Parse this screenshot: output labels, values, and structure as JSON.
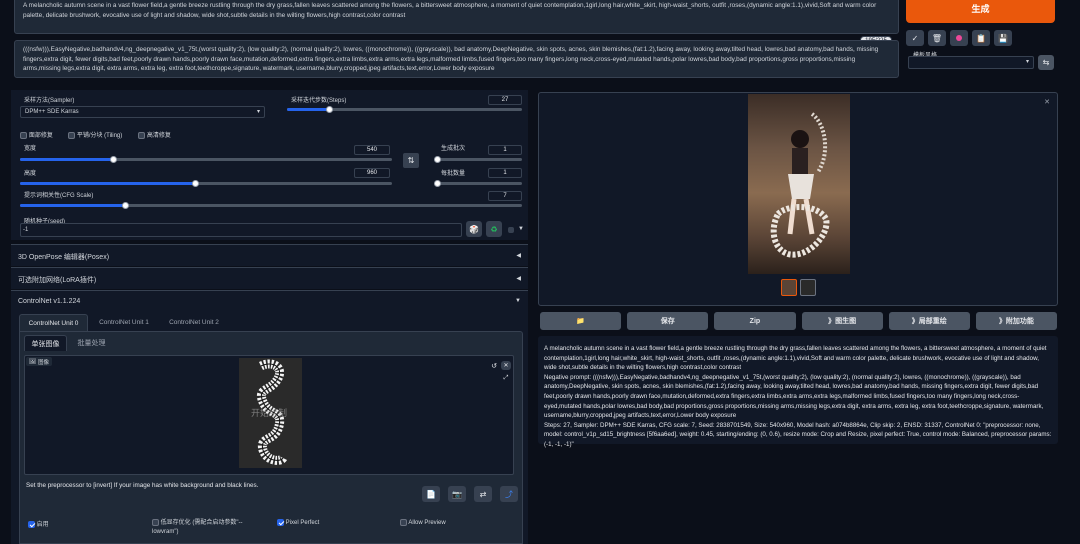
{
  "prompt": {
    "text": "A melancholic autumn scene in a vast flower field,a gentle breeze rustling through the dry grass,fallen leaves scattered among the flowers, a bittersweet atmosphere, a moment of quiet contemplation,1girl,long hair,white_skirt, high-waist_shorts, outfit ,roses,(dynamic angle:1.1),vivid,Soft and warm color palette, delicate brushwork, evocative use of light and shadow, wide shot,subtle details in the wilting flowers,high contrast,color contrast",
    "token_count": "195/225"
  },
  "negative_prompt": {
    "text": "(((nsfw))),EasyNegative,badhandv4,ng_deepnegative_v1_75t,(worst quality:2), (low quality:2), (normal quality:2), lowres, ((monochrome)), ((grayscale)), bad anatomy,DeepNegative, skin spots, acnes, skin blemishes,(fat:1.2),facing away, looking away,tilted head, lowres,bad anatomy,bad hands, missing fingers,extra digit, fewer digits,bad feet,poorly drawn hands,poorly drawn face,mutation,deformed,extra fingers,extra limbs,extra arms,extra legs,malformed limbs,fused fingers,too many fingers,long neck,cross-eyed,mutated hands,polar lowres,bad body,bad proportions,gross proportions,missing arms,missing legs,extra digit, extra arms, extra leg, extra foot,teethcroppe,signature, watermark, username,blurry,cropped,jpeg artifacts,text,error,Lower body exposure"
  },
  "generate_label": "生成",
  "style_label": "模板风格",
  "tool_icons": [
    "check-icon",
    "trash-icon",
    "pink-dot-icon",
    "clipboard-icon",
    "save-icon"
  ],
  "sampler": {
    "label": "采样方法(Sampler)",
    "value": "DPM++ SDE Karras"
  },
  "steps": {
    "label": "采样迭代步数(Steps)",
    "value": "27",
    "fraction": 0.18
  },
  "checkboxes": {
    "hires": "面部修复",
    "tiling": "平铺/分块 (Tiling)",
    "highres": "高清修复"
  },
  "width": {
    "label": "宽度",
    "value": "540",
    "fraction": 0.25
  },
  "height": {
    "label": "高度",
    "value": "960",
    "fraction": 0.47
  },
  "batch_count": {
    "label": "生成批次",
    "value": "1",
    "fraction": 0.0
  },
  "batch_size": {
    "label": "每批数量",
    "value": "1",
    "fraction": 0.0
  },
  "cfg": {
    "label": "提示词相关性(CFG Scale)",
    "value": "7",
    "fraction": 0.21
  },
  "seed": {
    "label": "随机种子(seed)",
    "value": "-1"
  },
  "sections": {
    "openpose": "3D OpenPose 编辑器(Posex)",
    "lora": "可选附加网络(LoRA插件)",
    "controlnet": "ControlNet v1.1.224"
  },
  "cn_tabs": [
    "ControlNet Unit 0",
    "ControlNet Unit 1",
    "ControlNet Unit 2"
  ],
  "img_tabs": {
    "single": "单张图像",
    "batch": "批量处理"
  },
  "image_label": "图像",
  "watermark": "开始绘制",
  "preprocessor_hint": "Set the preprocessor to [invert] If your image has white background and black lines.",
  "cn_options": {
    "enable": "启用",
    "lowvram": "低显存优化 (需配合启动参数\"--lowvram\")",
    "pixel_perfect": "Pixel Perfect",
    "allow_preview": "Allow Preview"
  },
  "output_buttons": [
    "📁",
    "保存",
    "Zip",
    "》图生图",
    "》局部重绘",
    "》附加功能"
  ],
  "info": {
    "prompt": "A melancholic autumn scene in a vast flower field,a gentle breeze rustling through the dry grass,fallen leaves scattered among the flowers, a bittersweet atmosphere, a moment of quiet contemplation,1girl,long hair,white_skirt, high-waist_shorts, outfit ,roses,(dynamic angle:1.1),vivid,Soft and warm color palette, delicate brushwork, evocative use of light and shadow, wide shot,subtle details in the wilting flowers,high contrast,color contrast",
    "negative": "Negative prompt: (((nsfw))),EasyNegative,badhandv4,ng_deepnegative_v1_75t,(worst quality:2), (low quality:2), (normal quality:2), lowres, ((monochrome)), ((grayscale)), bad anatomy,DeepNegative, skin spots, acnes, skin blemishes,(fat:1.2),facing away, looking away,tilted head, lowres,bad anatomy,bad hands, missing fingers,extra digit, fewer digits,bad feet,poorly drawn hands,poorly drawn face,mutation,deformed,extra fingers,extra limbs,extra arms,extra legs,malformed limbs,fused fingers,too many fingers,long neck,cross-eyed,mutated hands,polar lowres,bad body,bad proportions,gross proportions,missing arms,missing legs,extra digit, extra arms, extra leg, extra foot,teethcroppe,signature, watermark, username,blurry,cropped,jpeg artifacts,text,error,Lower body exposure",
    "params": "Steps: 27, Sampler: DPM++ SDE Karras, CFG scale: 7, Seed: 2838701549, Size: 540x960, Model hash: a074b8864e, Clip skip: 2, ENSD: 31337, ControlNet 0: \"preprocessor: none, model: control_v1p_sd15_brightness [5f6aa6ed], weight: 0.45, starting/ending: (0, 0.6), resize mode: Crop and Resize, pixel perfect: True, control mode: Balanced, preprocessor params: (-1, -1, -1)\""
  },
  "colors": {
    "accent": "#ea580c",
    "blue": "#2563eb"
  }
}
